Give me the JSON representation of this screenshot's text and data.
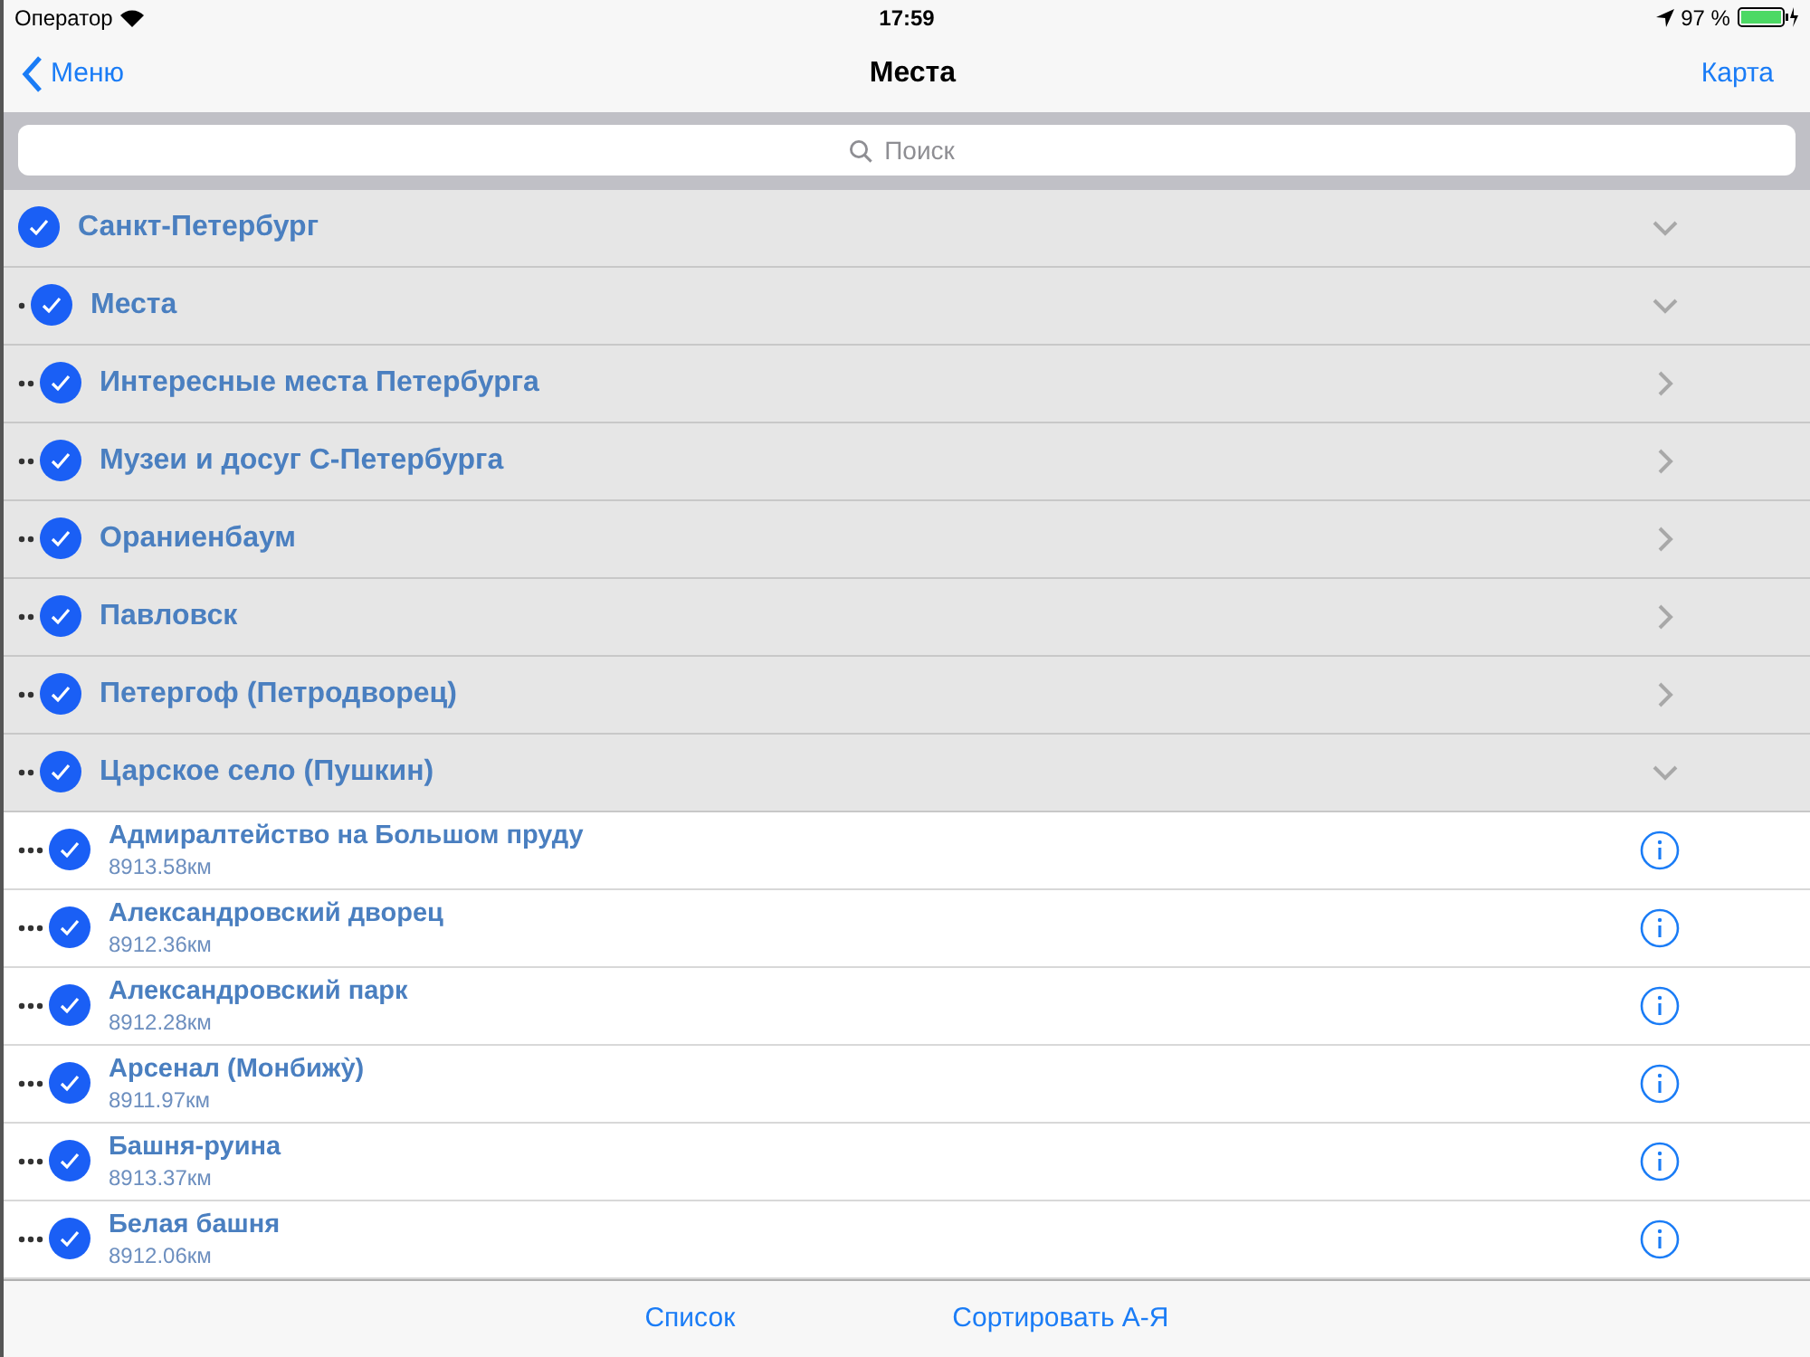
{
  "status_bar": {
    "carrier": "Оператор",
    "time": "17:59",
    "battery": "97 %"
  },
  "nav_bar": {
    "back": "Меню",
    "title": "Места",
    "action": "Карта"
  },
  "search": {
    "placeholder": "Поиск"
  },
  "tree": [
    {
      "kind": "group",
      "label": "Санкт-Петербург",
      "checked": true,
      "expanded": true,
      "children": [
        {
          "kind": "group",
          "label": "Места",
          "checked": true,
          "expanded": true,
          "children": [
            {
              "kind": "group",
              "label": "Интересные места Петербурга",
              "checked": true,
              "expanded": false
            },
            {
              "kind": "group",
              "label": "Музеи и досуг С-Петербурга",
              "checked": true,
              "expanded": false
            },
            {
              "kind": "group",
              "label": "Ораниенбаум",
              "checked": true,
              "expanded": false
            },
            {
              "kind": "group",
              "label": "Павловск",
              "checked": true,
              "expanded": false
            },
            {
              "kind": "group",
              "label": "Петергоф (Петродворец)",
              "checked": true,
              "expanded": false
            },
            {
              "kind": "group",
              "label": "Царское село (Пушкин)",
              "checked": true,
              "expanded": true,
              "children": [
                {
                  "kind": "place",
                  "label": "Адмиралтейство на Большом пруду",
                  "distance": "8913.58км",
                  "checked": true
                },
                {
                  "kind": "place",
                  "label": "Александровский дворец",
                  "distance": "8912.36км",
                  "checked": true
                },
                {
                  "kind": "place",
                  "label": "Александровский парк",
                  "distance": "8912.28км",
                  "checked": true
                },
                {
                  "kind": "place",
                  "label": "Арсенал (Монбижу̀)",
                  "distance": "8911.97км",
                  "checked": true
                },
                {
                  "kind": "place",
                  "label": "Башня-руина",
                  "distance": "8913.37км",
                  "checked": true
                },
                {
                  "kind": "place",
                  "label": "Белая башня",
                  "distance": "8912.06км",
                  "checked": true
                }
              ]
            }
          ]
        }
      ]
    }
  ],
  "toolbar": [
    "Список",
    "Сортировать А-Я"
  ]
}
